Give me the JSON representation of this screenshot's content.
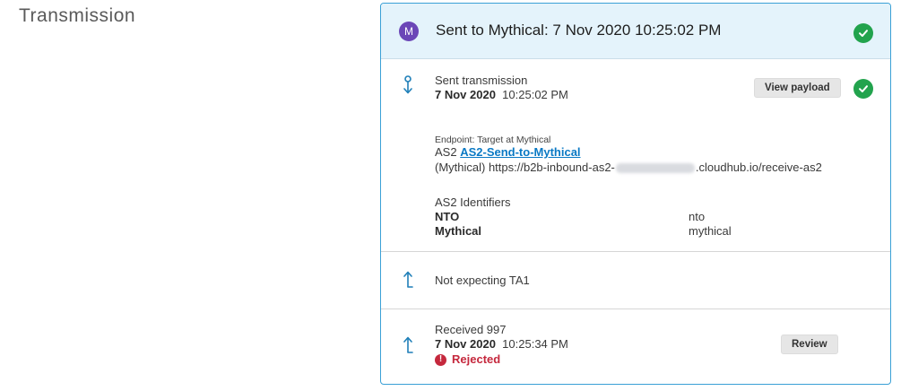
{
  "section": {
    "title": "Transmission"
  },
  "header": {
    "avatar_letter": "M",
    "title": "Sent to Mythical: 7 Nov 2020 10:25:02 PM"
  },
  "sent": {
    "label": "Sent transmission",
    "date": "7 Nov 2020",
    "time": "10:25:02 PM",
    "view_payload_label": "View payload",
    "endpoint_label": "Endpoint: Target at Mythical",
    "protocol": "AS2",
    "endpoint_link": "AS2-Send-to-Mythical",
    "url_prefix": "(Mythical) https://b2b-inbound-as2-",
    "url_suffix": ".cloudhub.io/receive-as2",
    "identifiers_title": "AS2 Identifiers",
    "identifiers": [
      {
        "name": "NTO",
        "value": "nto"
      },
      {
        "name": "Mythical",
        "value": "mythical"
      }
    ]
  },
  "ta1": {
    "label": "Not expecting TA1"
  },
  "received": {
    "label": "Received 997",
    "date": "7 Nov 2020",
    "time": "10:25:34 PM",
    "status": "Rejected",
    "review_label": "Review"
  },
  "colors": {
    "accent": "#3aa0d6",
    "success": "#22a34d",
    "error": "#c5283d",
    "avatar": "#6b46b7",
    "link": "#0a79c4"
  }
}
